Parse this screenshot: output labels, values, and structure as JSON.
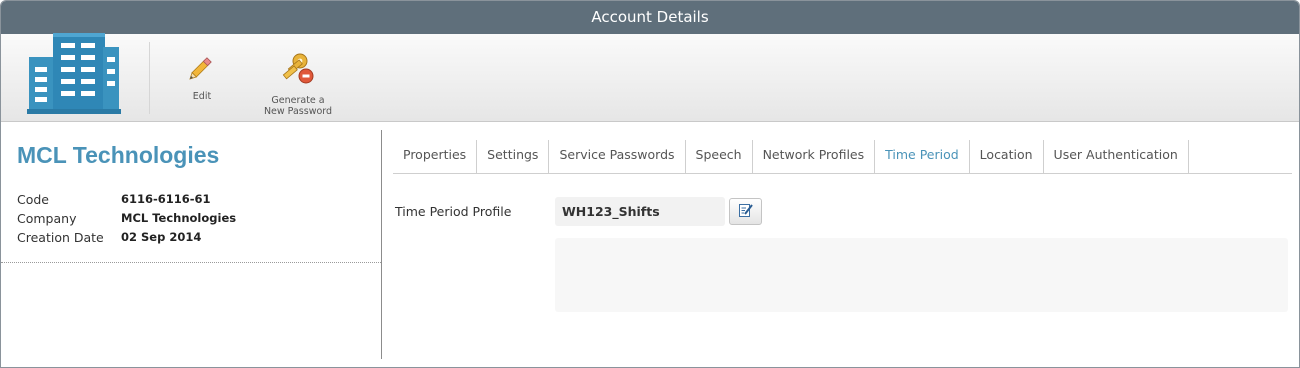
{
  "window": {
    "title": "Account Details"
  },
  "toolbar": {
    "logo_icon": "building-icon",
    "edit": {
      "label": "Edit",
      "icon": "pencil-icon"
    },
    "generate_password": {
      "label_line1": "Generate a",
      "label_line2": "New Password",
      "icon": "key-lock-icon"
    }
  },
  "account": {
    "name": "MCL Technologies",
    "fields": [
      {
        "label": "Code",
        "value": "6116-6116-61"
      },
      {
        "label": "Company",
        "value": "MCL Technologies"
      },
      {
        "label": "Creation Date",
        "value": "02 Sep 2014"
      }
    ]
  },
  "tabs": [
    {
      "label": "Properties",
      "active": false
    },
    {
      "label": "Settings",
      "active": false
    },
    {
      "label": "Service Passwords",
      "active": false
    },
    {
      "label": "Speech",
      "active": false
    },
    {
      "label": "Network Profiles",
      "active": false
    },
    {
      "label": "Time Period",
      "active": true
    },
    {
      "label": "Location",
      "active": false
    },
    {
      "label": "User Authentication",
      "active": false
    }
  ],
  "time_period": {
    "label": "Time Period Profile",
    "value": "WH123_Shifts",
    "edit_icon": "edit-note-icon"
  },
  "colors": {
    "title_bar": "#5f6f7b",
    "accent": "#4a93b8"
  }
}
